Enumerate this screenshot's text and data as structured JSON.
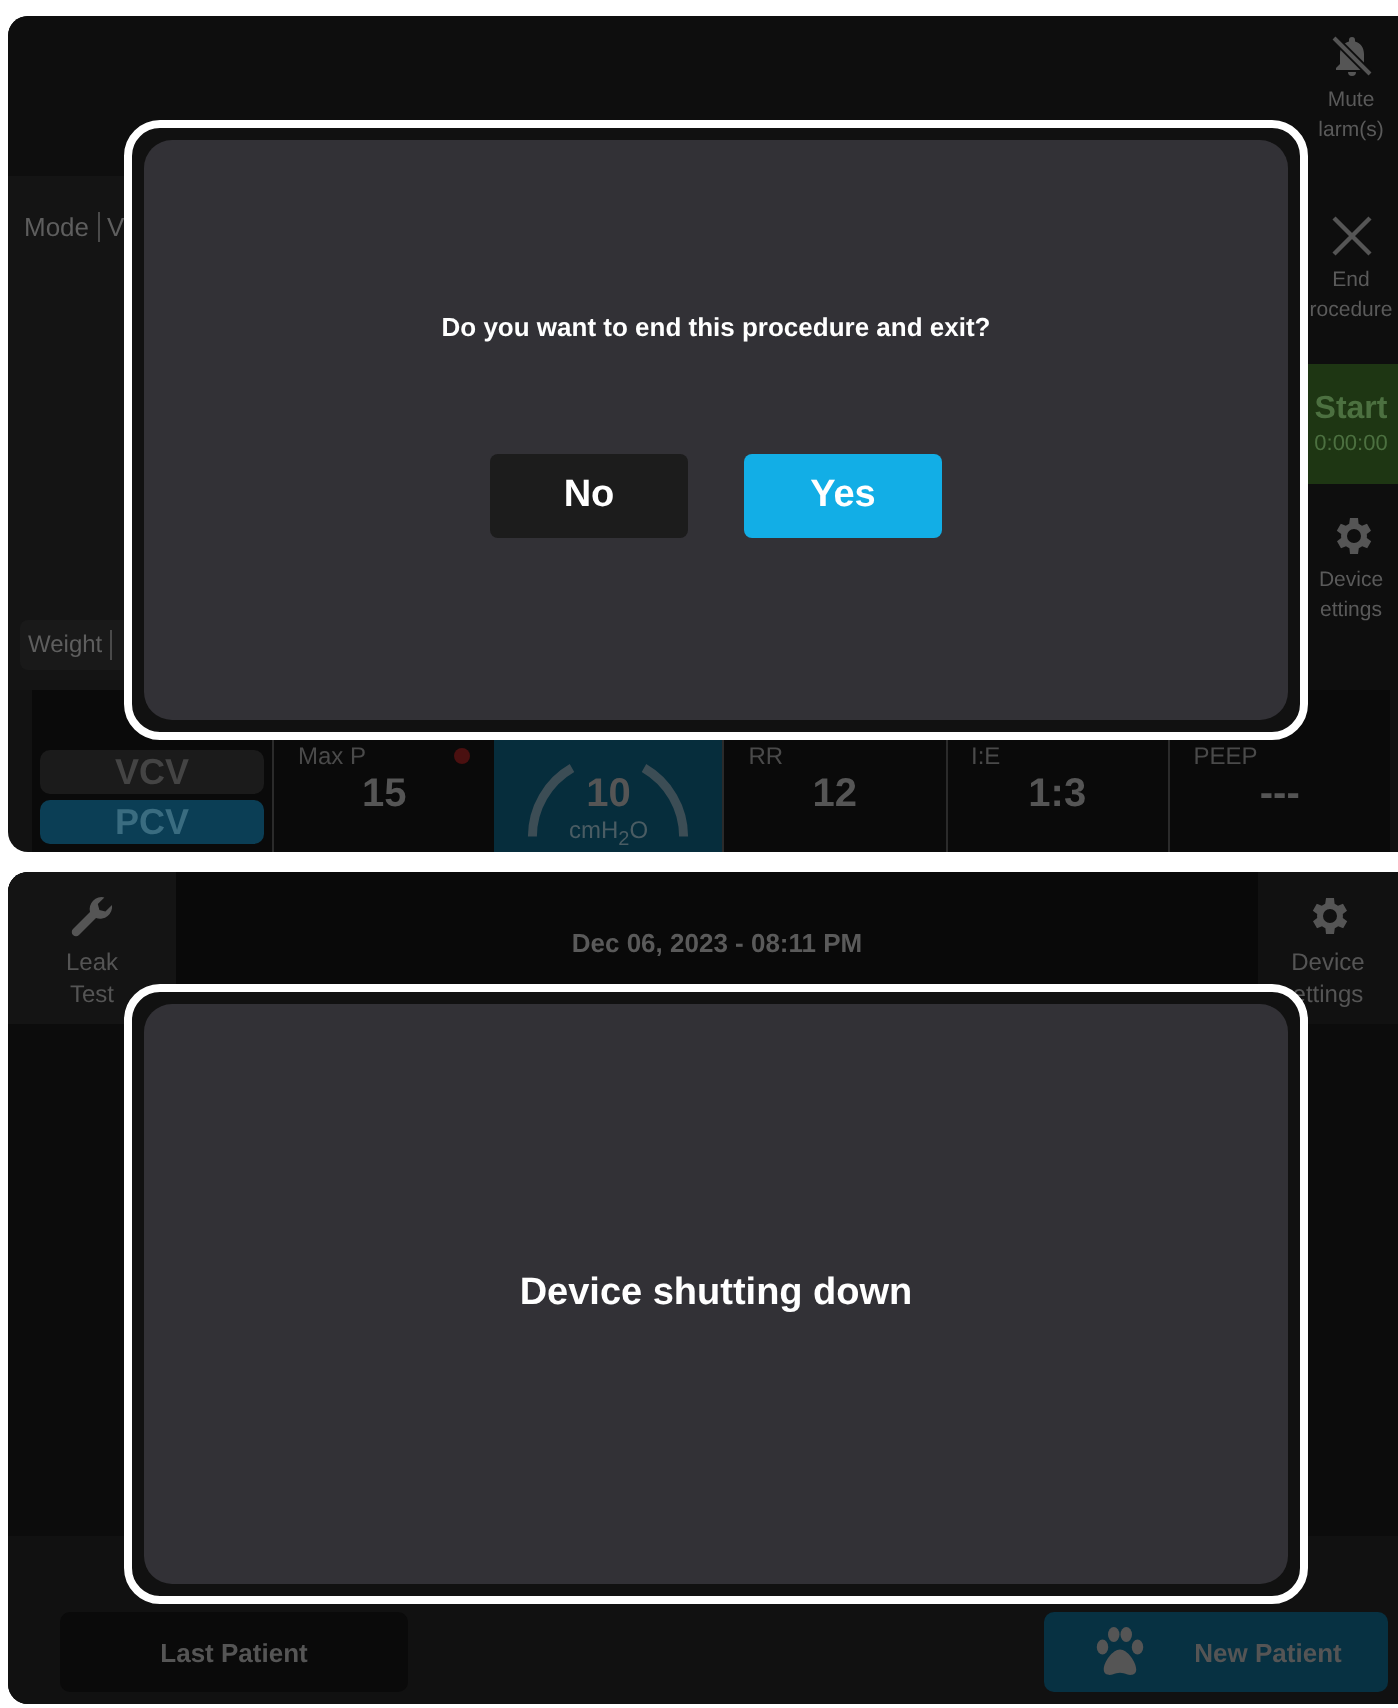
{
  "screen_1": {
    "side_buttons": [
      {
        "kind": "mute",
        "lines": [
          "Mute",
          "larm(s)"
        ]
      },
      {
        "kind": "end",
        "lines": [
          "End",
          "rocedure"
        ]
      },
      {
        "kind": "start",
        "lines": [
          "Start",
          "0:00:00"
        ]
      },
      {
        "kind": "settings",
        "lines": [
          "Device",
          "ettings"
        ]
      }
    ],
    "mode_label": "Mode",
    "mode_value": "V",
    "weight_label": "Weight",
    "modes": [
      {
        "label": "VCV",
        "selected": false
      },
      {
        "label": "PCV",
        "selected": true
      }
    ],
    "params": [
      {
        "label": "Max P",
        "value": "15",
        "alarm": true,
        "selected": false
      },
      {
        "value": "10",
        "unit": "cmH$_{2}$O",
        "selected": true
      },
      {
        "label": "RR",
        "value": "12",
        "selected": false
      },
      {
        "label": "I:E",
        "value": "1:3",
        "selected": false
      },
      {
        "label": "PEEP",
        "value": "---",
        "selected": false
      }
    ],
    "dialog": {
      "message": "Do you want to end this procedure and exit?",
      "buttons": [
        {
          "label": "No",
          "kind": "secondary"
        },
        {
          "label": "Yes",
          "kind": "primary"
        }
      ]
    }
  },
  "screen_2": {
    "leak_test": [
      "Leak",
      "Test"
    ],
    "datetime": "Dec 06, 2023 - 08:11 PM",
    "device_settings": [
      "Device",
      "ettings"
    ],
    "dialog": {
      "message": "Device shutting down"
    },
    "buttons": [
      {
        "label": "Last Patient",
        "kind": "plain"
      },
      {
        "label": "New Patient",
        "kind": "paw"
      }
    ]
  }
}
